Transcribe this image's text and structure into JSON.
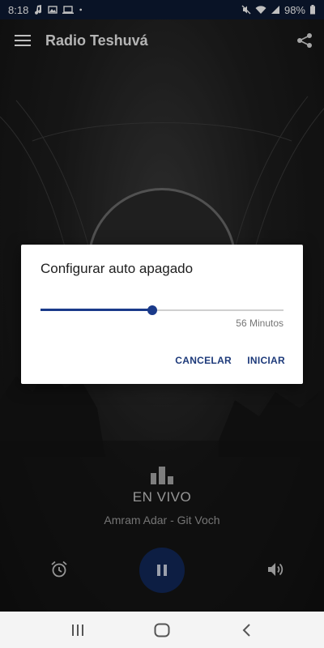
{
  "status_bar": {
    "time": "8:18",
    "battery": "98%",
    "left_icons": [
      "music-note-icon",
      "image-icon",
      "laptop-icon",
      "dot-icon"
    ],
    "right_icons": [
      "mute-icon",
      "wifi-icon",
      "signal-icon",
      "battery-icon"
    ]
  },
  "app_bar": {
    "title": "Radio Teshuvá",
    "menu_icon": "hamburger-menu-icon",
    "share_icon": "share-icon"
  },
  "player": {
    "live_label": "EN VIVO",
    "track": "Amram Adar - Git Voch",
    "play_state_icon": "pause-icon"
  },
  "dialog": {
    "title": "Configurar auto apagado",
    "slider_fraction": 0.46,
    "slider_value_label": "56 Minutos",
    "cancel_label": "CANCELAR",
    "start_label": "INICIAR"
  },
  "colors": {
    "accent": "#1a3a8a",
    "status_bar": "#0c1a33",
    "button_text": "#1d3a7a"
  },
  "nav_bar": {
    "icons": [
      "recent-apps-icon",
      "home-icon",
      "back-icon"
    ]
  }
}
